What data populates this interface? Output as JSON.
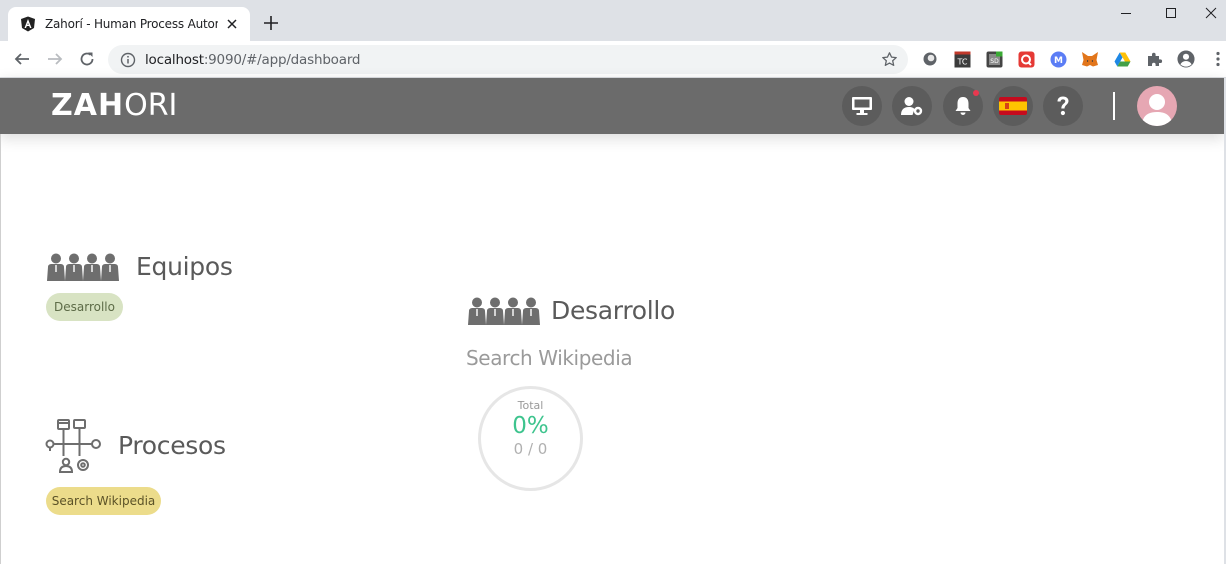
{
  "browser": {
    "tab_title": "Zahorí - Human Process Automati",
    "url_host": "localhost",
    "url_rest": ":9090/#/app/dashboard",
    "extensions": [
      "record-icon",
      "tc-extension-icon",
      "sd-extension-icon",
      "redbubble-extension-icon",
      "m-extension-icon",
      "metamask-fox-icon",
      "google-drive-icon",
      "puzzle-extensions-icon",
      "profile-icon",
      "kebab-menu-icon"
    ]
  },
  "header": {
    "logo_bold": "ZAH",
    "logo_mid": "O",
    "logo_tail": "RI",
    "buttons": [
      "monitor-icon",
      "user-settings-icon",
      "bell-icon",
      "spain-flag-icon",
      "help-icon"
    ],
    "notification": true,
    "colors": {
      "background": "#6b6b6b",
      "button": "#5c5c5c",
      "dot": "#e8384f",
      "avatar": "#e6a7b3"
    }
  },
  "teams": {
    "title": "Equipos",
    "chips": [
      "Desarrollo"
    ]
  },
  "processes": {
    "title": "Procesos",
    "chips": [
      "Search Wikipedia"
    ]
  },
  "team_detail": {
    "title": "Desarrollo",
    "process": "Search Wikipedia",
    "gauge": {
      "label": "Total",
      "percent": "0%",
      "count": "0 / 0"
    }
  }
}
